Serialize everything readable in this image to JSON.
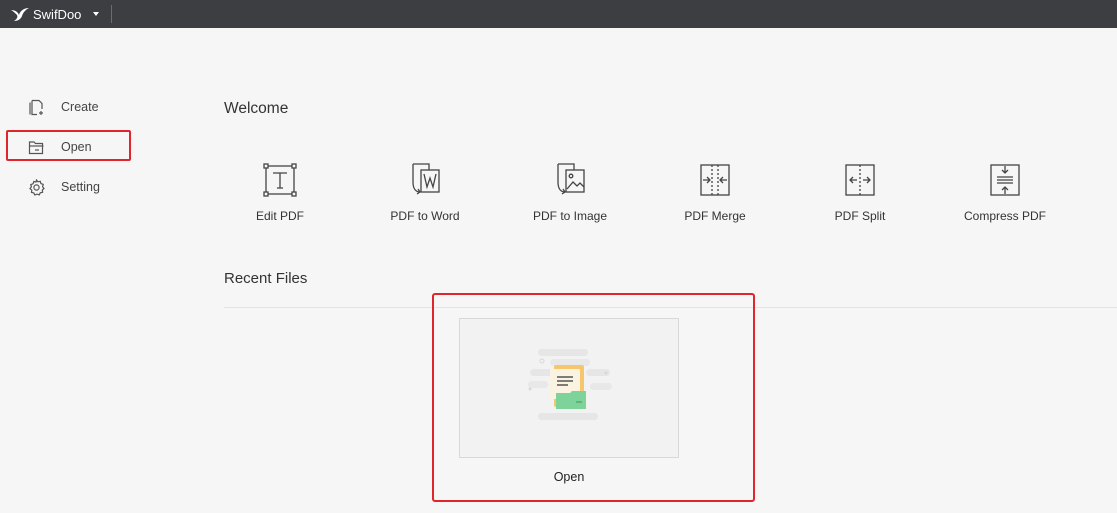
{
  "titlebar": {
    "app_name": "SwifDoo",
    "logo_icon": "swallow-icon",
    "menu_icon": "caret-down-icon"
  },
  "sidebar": {
    "items": [
      {
        "label": "Create",
        "icon": "file-plus-icon"
      },
      {
        "label": "Open",
        "icon": "folder-open-icon",
        "highlighted": true
      },
      {
        "label": "Setting",
        "icon": "gear-icon"
      }
    ]
  },
  "main": {
    "welcome_title": "Welcome",
    "tools": [
      {
        "label": "Edit PDF",
        "icon": "text-frame-icon"
      },
      {
        "label": "PDF to Word",
        "icon": "word-convert-icon"
      },
      {
        "label": "PDF to Image",
        "icon": "image-convert-icon"
      },
      {
        "label": "PDF Merge",
        "icon": "merge-icon"
      },
      {
        "label": "PDF Split",
        "icon": "split-icon"
      },
      {
        "label": "Compress PDF",
        "icon": "compress-icon"
      }
    ],
    "recent_title": "Recent Files",
    "recent_items": [
      {
        "label": "Open",
        "icon": "open-file-illustration-icon",
        "highlighted": true
      }
    ]
  },
  "colors": {
    "titlebar_bg": "#3c3e42",
    "page_bg": "#f6f6f6",
    "highlight": "#e0262b",
    "file_green": "#7ed39a",
    "file_orange": "#f7c56b"
  }
}
